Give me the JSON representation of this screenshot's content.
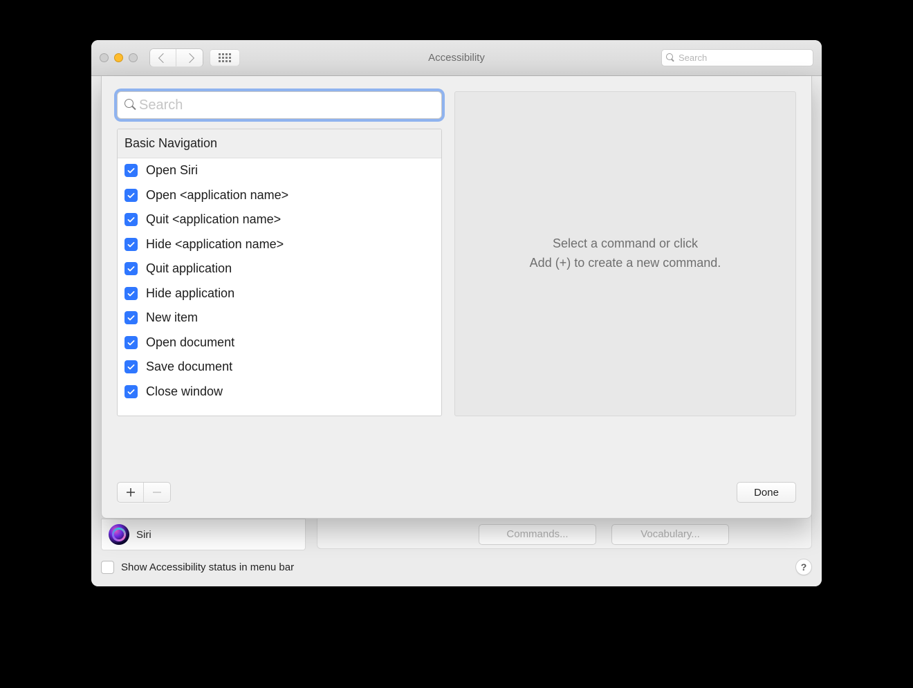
{
  "titlebar": {
    "title": "Accessibility",
    "search_placeholder": "Search"
  },
  "sheet": {
    "search_placeholder": "Search",
    "group_header": "Basic Navigation",
    "commands": [
      {
        "label": "Open Siri",
        "checked": true
      },
      {
        "label": "Open <application name>",
        "checked": true
      },
      {
        "label": "Quit <application name>",
        "checked": true
      },
      {
        "label": "Hide <application name>",
        "checked": true
      },
      {
        "label": "Quit application",
        "checked": true
      },
      {
        "label": "Hide application",
        "checked": true
      },
      {
        "label": "New item",
        "checked": true
      },
      {
        "label": "Open document",
        "checked": true
      },
      {
        "label": "Save document",
        "checked": true
      },
      {
        "label": "Close window",
        "checked": true
      }
    ],
    "right_hint_line1": "Select a command or click",
    "right_hint_line2": "Add (+) to create a new command.",
    "done_label": "Done"
  },
  "background": {
    "siri_label": "Siri",
    "commands_btn": "Commands...",
    "vocab_btn": "Vocabulary...",
    "status_checkbox_label": "Show Accessibility status in menu bar"
  }
}
